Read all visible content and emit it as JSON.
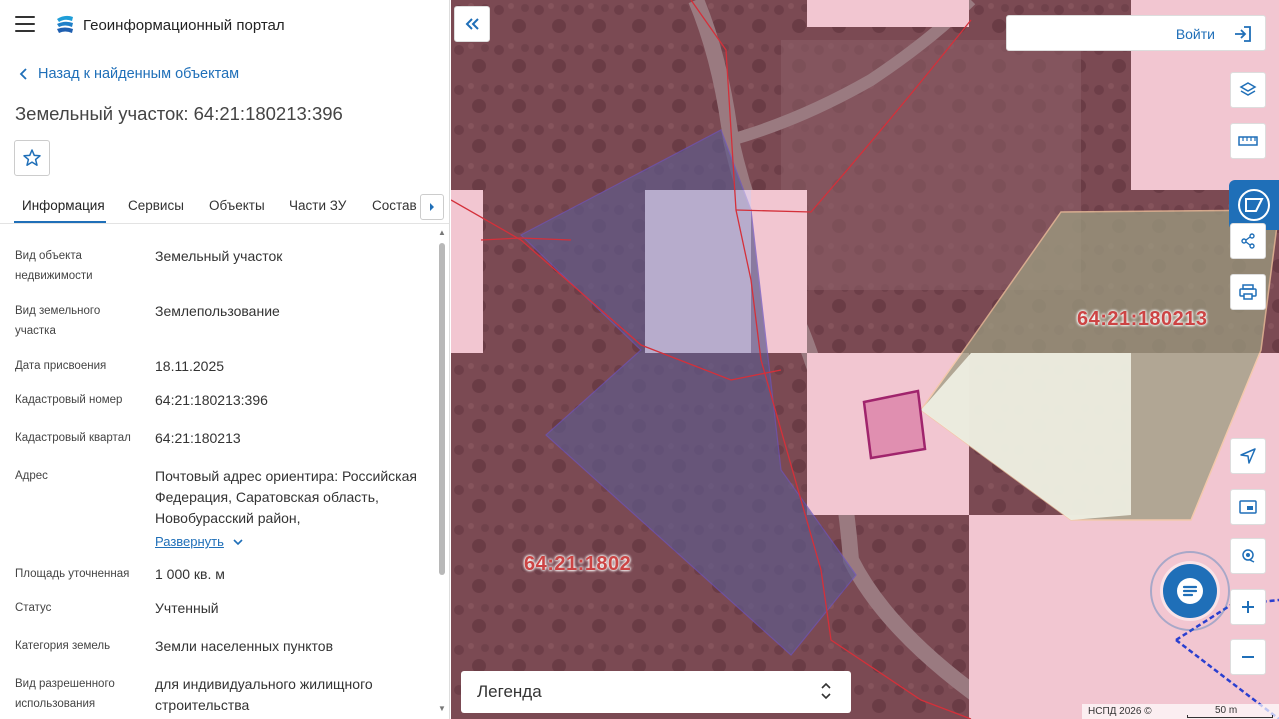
{
  "header": {
    "portal_title": "Геоинформационный портал",
    "menu_icon": "hamburger-icon",
    "logo_icon": "portal-logo-icon"
  },
  "nav": {
    "back_label": "Назад к найденным объектам"
  },
  "object": {
    "title": "Земельный участок: 64:21:180213:396"
  },
  "tabs": [
    {
      "label": "Информация",
      "active": true
    },
    {
      "label": "Сервисы"
    },
    {
      "label": "Объекты"
    },
    {
      "label": "Части ЗУ"
    },
    {
      "label": "Состав"
    }
  ],
  "properties": [
    {
      "label": "Вид объекта недвижимости",
      "value": "Земельный участок"
    },
    {
      "label": "Вид земельного участка",
      "value": "Землепользование"
    },
    {
      "label": "Дата присвоения",
      "value": "18.11.2025"
    },
    {
      "label": "Кадастровый номер",
      "value": "64:21:180213:396"
    },
    {
      "label": "Кадастровый квартал",
      "value": "64:21:180213"
    },
    {
      "label": "Адрес",
      "value": "Почтовый адрес ориентира: Российская Федерация, Саратовская область, Новобурасский район,",
      "expand_label": "Развернуть"
    },
    {
      "label": "Площадь уточненная",
      "value": "1 000 кв. м"
    },
    {
      "label": "Статус",
      "value": "Учтенный"
    },
    {
      "label": "Категория земель",
      "value": "Земли населенных пунктов"
    },
    {
      "label": "Вид разрешенного использования",
      "value": "для индивидуального жилищного строительства"
    }
  ],
  "map": {
    "login_label": "Войти",
    "legend_label": "Легенда",
    "label_quarter_right": "64:21:180213",
    "label_quarter_left": "64:21:1802",
    "attribution": "НСПД 2026 ©",
    "scale_label": "50 m",
    "accent_color": "#1f6fb8"
  }
}
